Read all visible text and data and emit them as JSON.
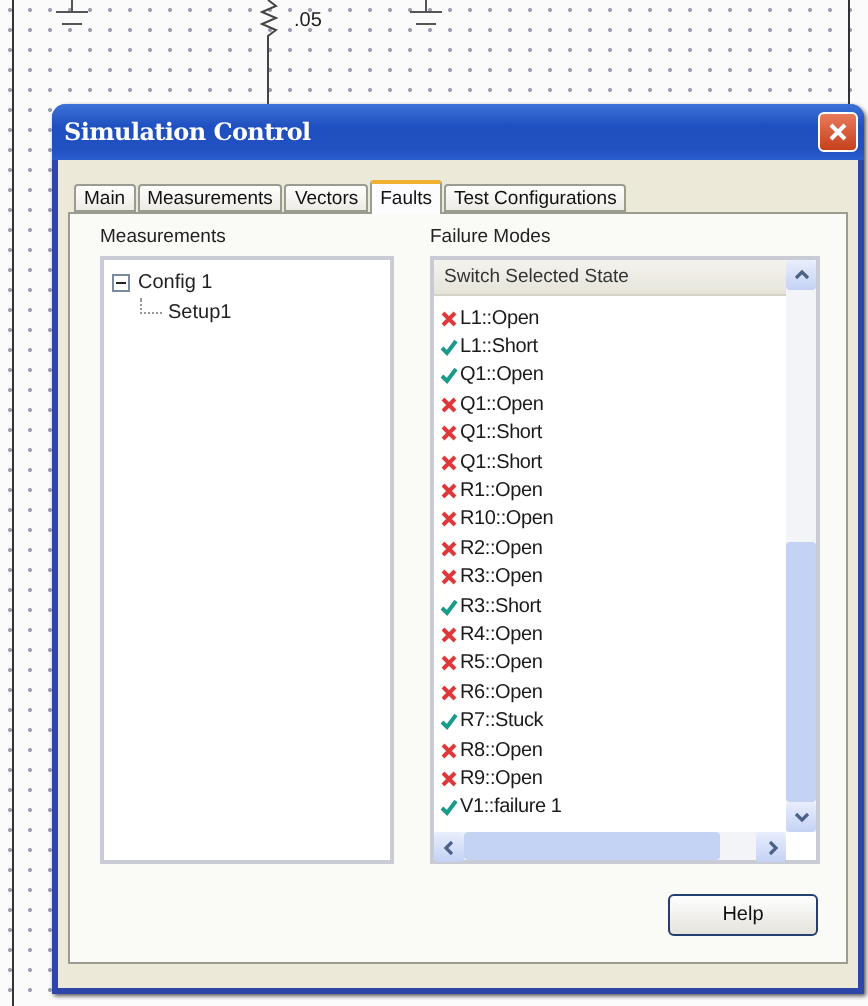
{
  "schematic": {
    "resistor_value": ".05"
  },
  "window": {
    "title": "Simulation Control"
  },
  "tabs": [
    {
      "label": "Main",
      "selected": false
    },
    {
      "label": "Measurements",
      "selected": false
    },
    {
      "label": "Vectors",
      "selected": false
    },
    {
      "label": "Faults",
      "selected": true
    },
    {
      "label": "Test Configurations",
      "selected": false
    }
  ],
  "measurements": {
    "label": "Measurements",
    "tree": [
      {
        "label": "Config 1",
        "expanded": true,
        "children": [
          {
            "label": "Setup1"
          }
        ]
      }
    ]
  },
  "failure_modes": {
    "label": "Failure Modes",
    "header": "Switch Selected State",
    "items": [
      {
        "label": "L1::Open",
        "checked": false
      },
      {
        "label": "L1::Short",
        "checked": true
      },
      {
        "label": "Q1::Open",
        "checked": true
      },
      {
        "label": "Q1::Open",
        "checked": false
      },
      {
        "label": "Q1::Short",
        "checked": false
      },
      {
        "label": "Q1::Short",
        "checked": false
      },
      {
        "label": "R1::Open",
        "checked": false
      },
      {
        "label": "R10::Open",
        "checked": false
      },
      {
        "label": "R2::Open",
        "checked": false
      },
      {
        "label": "R3::Open",
        "checked": false
      },
      {
        "label": "R3::Short",
        "checked": true
      },
      {
        "label": "R4::Open",
        "checked": false
      },
      {
        "label": "R5::Open",
        "checked": false
      },
      {
        "label": "R6::Open",
        "checked": false
      },
      {
        "label": "R7::Stuck",
        "checked": true
      },
      {
        "label": "R8::Open",
        "checked": false
      },
      {
        "label": "R9::Open",
        "checked": false
      },
      {
        "label": "V1::failure 1",
        "checked": true
      }
    ]
  },
  "buttons": [
    {
      "label": "Help"
    }
  ]
}
